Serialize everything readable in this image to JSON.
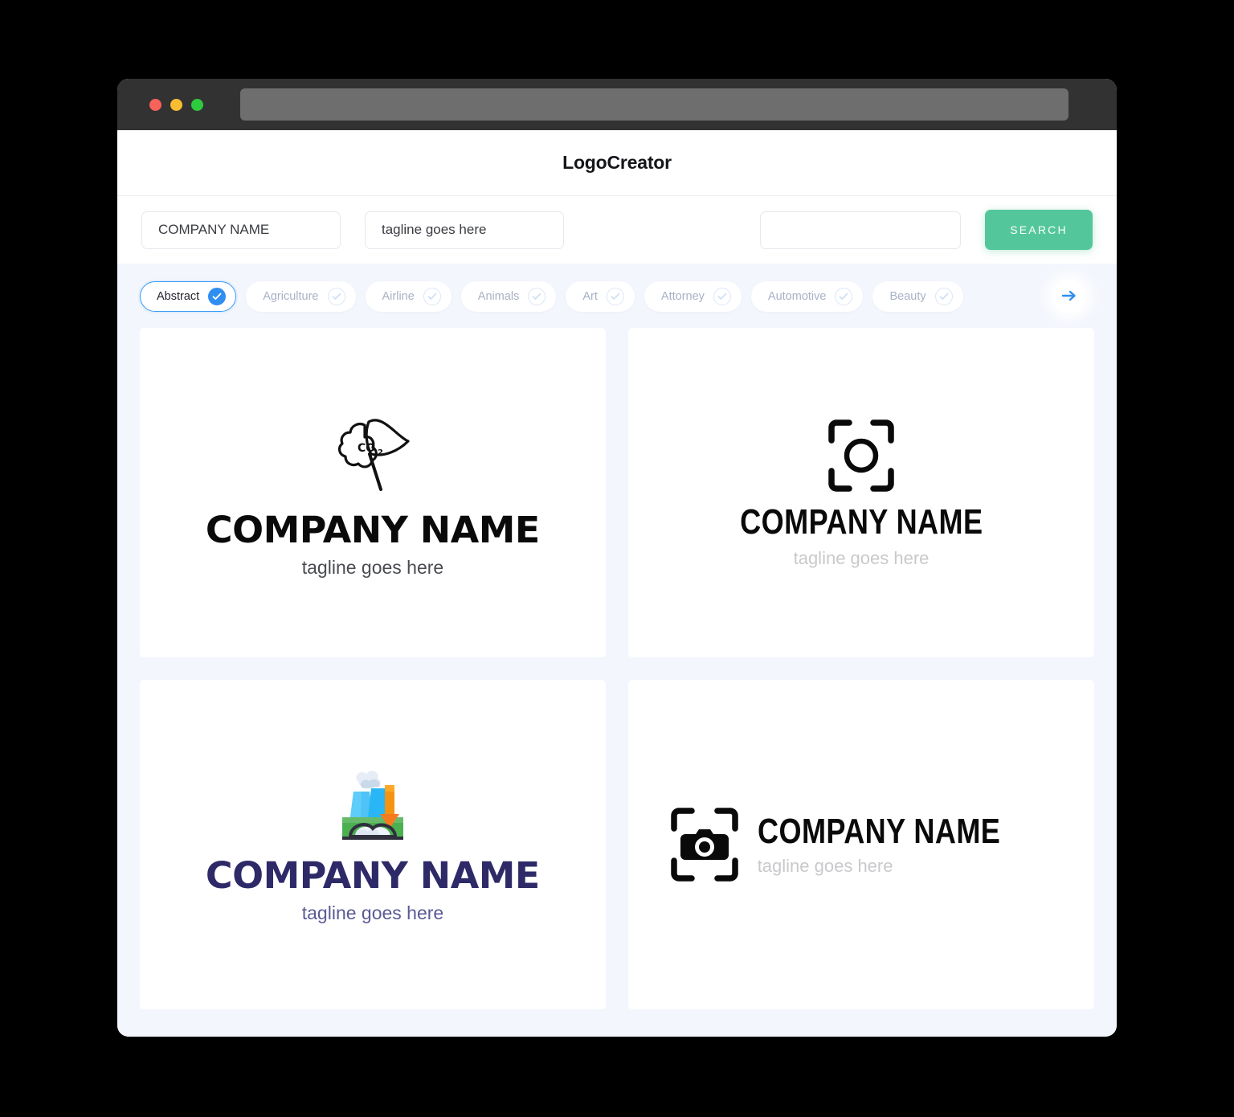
{
  "window": {
    "traffic_lights": [
      "close",
      "minimize",
      "maximize"
    ],
    "address_bar_value": ""
  },
  "header": {
    "brand": "LogoCreator"
  },
  "search": {
    "company_value": "COMPANY NAME",
    "company_placeholder": "COMPANY NAME",
    "tagline_value": "tagline goes here",
    "tagline_placeholder": "tagline goes here",
    "keyword_value": "",
    "keyword_placeholder": "",
    "button_label": "SEARCH",
    "button_color": "#53c79b"
  },
  "categories": {
    "next_label": "→",
    "items": [
      {
        "label": "Abstract",
        "selected": true
      },
      {
        "label": "Agriculture",
        "selected": false
      },
      {
        "label": "Airline",
        "selected": false
      },
      {
        "label": "Animals",
        "selected": false
      },
      {
        "label": "Art",
        "selected": false
      },
      {
        "label": "Attorney",
        "selected": false
      },
      {
        "label": "Automotive",
        "selected": false
      },
      {
        "label": "Beauty",
        "selected": false
      }
    ],
    "active_color": "#2f8ff0",
    "inactive_text_color": "#a9b1c6"
  },
  "results": [
    {
      "icon": "co2-flag-icon",
      "name": "COMPANY NAME",
      "tagline": "tagline goes here",
      "name_color": "#0a0a0a",
      "tagline_color": "#4a4c52",
      "layout": "stacked"
    },
    {
      "icon": "camera-focus-outline-icon",
      "name": "COMPANY NAME",
      "tagline": "tagline goes here",
      "name_color": "#0a0a0a",
      "tagline_color": "#c9c9cc",
      "layout": "stacked"
    },
    {
      "icon": "co2-factory-color-icon",
      "name": "COMPANY NAME",
      "tagline": "tagline goes here",
      "name_color": "#2e2a68",
      "tagline_color": "#5b5a94",
      "layout": "stacked"
    },
    {
      "icon": "camera-focus-solid-icon",
      "name": "COMPANY NAME",
      "tagline": "tagline goes here",
      "name_color": "#0a0a0a",
      "tagline_color": "#c9c9cc",
      "layout": "inline"
    }
  ]
}
